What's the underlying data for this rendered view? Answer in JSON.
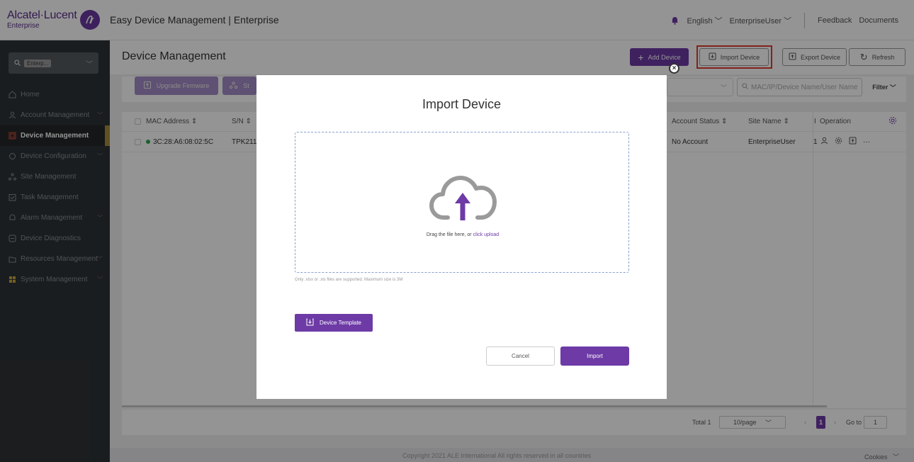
{
  "header": {
    "brand": "Alcatel·Lucent",
    "brand_sub": "Enterprise",
    "app_title": "Easy Device Management | Enterprise",
    "language": "English",
    "user": "EnterpriseUser",
    "feedback": "Feedback",
    "documents": "Documents"
  },
  "sidebar": {
    "search_chip": "Enterp...",
    "items": [
      {
        "label": "Home",
        "icon": "home-icon",
        "expandable": false
      },
      {
        "label": "Account Management",
        "icon": "user-icon",
        "expandable": true
      },
      {
        "label": "Device Management",
        "icon": "device-icon",
        "expandable": false
      },
      {
        "label": "Device Configuration",
        "icon": "config-icon",
        "expandable": true
      },
      {
        "label": "Site Management",
        "icon": "site-icon",
        "expandable": false
      },
      {
        "label": "Task Management",
        "icon": "task-icon",
        "expandable": false
      },
      {
        "label": "Alarm Management",
        "icon": "alarm-icon",
        "expandable": true
      },
      {
        "label": "Device Diagnostics",
        "icon": "diagnostics-icon",
        "expandable": false
      },
      {
        "label": "Resources Management",
        "icon": "resources-icon",
        "expandable": true
      },
      {
        "label": "System Management",
        "icon": "system-icon",
        "expandable": true
      }
    ]
  },
  "main": {
    "title": "Device Management",
    "actions": {
      "add": "Add Device",
      "import": "Import Device",
      "export": "Export Device",
      "refresh": "Refresh"
    },
    "toolbar": {
      "upgrade": "Upgrade Firmware",
      "second": "St",
      "search_placeholder": "MAC/IP/Device Name/User Name",
      "filter": "Filter"
    },
    "table": {
      "headers": {
        "mac": "MAC Address ⇕",
        "sn": "S/N ⇕",
        "account_status": "Account Status ⇕",
        "site_name": "Site Name ⇕",
        "col_i": "I",
        "operation": "Operation"
      },
      "rows": [
        {
          "mac": "3C:28:A6:08:02:5C",
          "sn": "TPK211",
          "account_status": "No Account",
          "site_name": "EnterpriseUser",
          "col_i": "1"
        }
      ]
    },
    "pager": {
      "total": "Total 1",
      "page_size": "10/page",
      "current": "1",
      "goto_label": "Go to",
      "goto_value": "1"
    },
    "footer": {
      "copyright": "Copyright 2021 ALE International All rights reserved in all countries",
      "cookies": "Cookies"
    }
  },
  "modal": {
    "title": "Import Device",
    "drop_text": "Drag the file here, or ",
    "drop_link": "click upload",
    "hint": "Only .xlsx or .xls files are supported. Maximum size is 3M",
    "template_button": "Device Template",
    "cancel_button": "Cancel",
    "import_button": "Import"
  },
  "colors": {
    "accent": "#6d3aa6",
    "highlight_box": "#e23b30",
    "online_dot": "#2fa84f"
  }
}
